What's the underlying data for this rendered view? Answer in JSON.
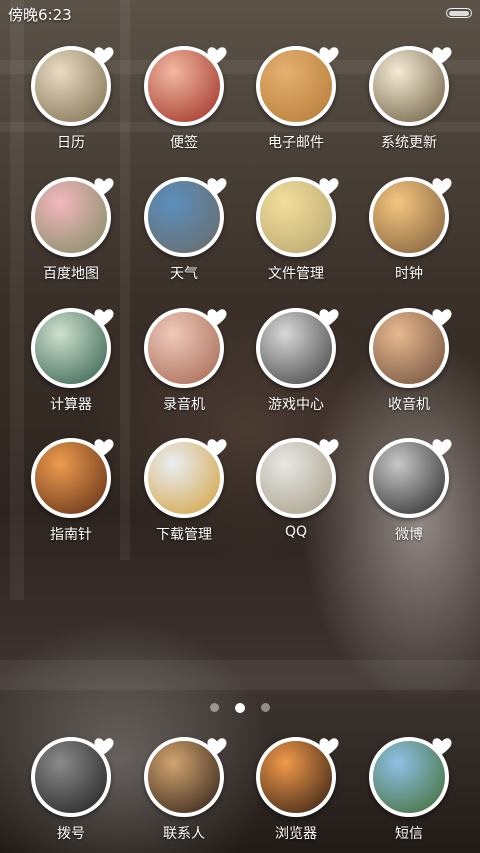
{
  "status_bar": {
    "time": "傍晚6:23"
  },
  "apps": [
    {
      "label": "日历",
      "icon": "calendar-icon",
      "c1": "#e9dcc2",
      "c2": "#7c6b4e"
    },
    {
      "label": "便签",
      "icon": "notes-icon",
      "c1": "#f2b8a2",
      "c2": "#9c2d22"
    },
    {
      "label": "电子邮件",
      "icon": "email-icon",
      "c1": "#e4b070",
      "c2": "#b57a35"
    },
    {
      "label": "系统更新",
      "icon": "system-update-icon",
      "c1": "#f4ebd6",
      "c2": "#6a5a3c"
    },
    {
      "label": "百度地图",
      "icon": "baidu-map-icon",
      "c1": "#f4b7be",
      "c2": "#7d8b60"
    },
    {
      "label": "天气",
      "icon": "weather-icon",
      "c1": "#5c8fbd",
      "c2": "#6a6a66"
    },
    {
      "label": "文件管理",
      "icon": "file-manager-icon",
      "c1": "#f3df9c",
      "c2": "#b6a46d"
    },
    {
      "label": "时钟",
      "icon": "clock-icon",
      "c1": "#f6c67f",
      "c2": "#7b5b3a"
    },
    {
      "label": "计算器",
      "icon": "calculator-icon",
      "c1": "#cfe1cf",
      "c2": "#2f5c49"
    },
    {
      "label": "录音机",
      "icon": "recorder-icon",
      "c1": "#f0c9bb",
      "c2": "#a2664f"
    },
    {
      "label": "游戏中心",
      "icon": "game-center-icon",
      "c1": "#d8d8d8",
      "c2": "#3d3d3d"
    },
    {
      "label": "收音机",
      "icon": "radio-icon",
      "c1": "#e7b98f",
      "c2": "#6d4d3b"
    },
    {
      "label": "指南针",
      "icon": "compass-icon",
      "c1": "#ee9c4f",
      "c2": "#5c2c14"
    },
    {
      "label": "下载管理",
      "icon": "download-manager-icon",
      "c1": "#e9eef3",
      "c2": "#d3a03c"
    },
    {
      "label": "QQ",
      "icon": "qq-icon",
      "c1": "#e6e8e4",
      "c2": "#a79b84"
    },
    {
      "label": "微博",
      "icon": "weibo-icon",
      "c1": "#c8c8c8",
      "c2": "#262626"
    }
  ],
  "dock": [
    {
      "label": "拨号",
      "icon": "dialer-icon",
      "c1": "#8a8a8a",
      "c2": "#1e1e1e"
    },
    {
      "label": "联系人",
      "icon": "contacts-icon",
      "c1": "#d2a470",
      "c2": "#2b1d14"
    },
    {
      "label": "浏览器",
      "icon": "browser-icon",
      "c1": "#f29a4a",
      "c2": "#2c1b12"
    },
    {
      "label": "短信",
      "icon": "messages-icon",
      "c1": "#8fc0e6",
      "c2": "#3f6b2c"
    }
  ],
  "pager": {
    "count": 3,
    "active": 1
  }
}
